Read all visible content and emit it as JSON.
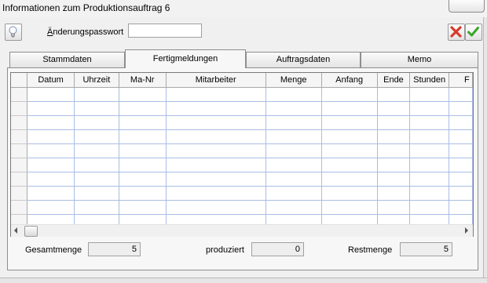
{
  "window": {
    "title": "Informationen zum Produktionsauftrag 6"
  },
  "toolbar": {
    "password_label": "Änderungspasswort",
    "password_value": "",
    "hint_icon": "lightbulb-icon",
    "cancel_icon": "red-x-icon",
    "ok_icon": "green-check-icon"
  },
  "tabs": [
    {
      "label": "Stammdaten",
      "active": false
    },
    {
      "label": "Fertigmeldungen",
      "active": true
    },
    {
      "label": "Auftragsdaten",
      "active": false
    },
    {
      "label": "Memo",
      "active": false
    }
  ],
  "grid": {
    "columns": [
      "Datum",
      "Uhrzeit",
      "Ma-Nr",
      "Mitarbeiter",
      "Menge",
      "Anfang",
      "Ende",
      "Stunden",
      "F"
    ],
    "rows": [
      [
        "",
        "",
        "",
        "",
        "",
        "",
        "",
        "",
        ""
      ],
      [
        "",
        "",
        "",
        "",
        "",
        "",
        "",
        "",
        ""
      ],
      [
        "",
        "",
        "",
        "",
        "",
        "",
        "",
        "",
        ""
      ],
      [
        "",
        "",
        "",
        "",
        "",
        "",
        "",
        "",
        ""
      ],
      [
        "",
        "",
        "",
        "",
        "",
        "",
        "",
        "",
        ""
      ],
      [
        "",
        "",
        "",
        "",
        "",
        "",
        "",
        "",
        ""
      ],
      [
        "",
        "",
        "",
        "",
        "",
        "",
        "",
        "",
        ""
      ],
      [
        "",
        "",
        "",
        "",
        "",
        "",
        "",
        "",
        ""
      ],
      [
        "",
        "",
        "",
        "",
        "",
        "",
        "",
        "",
        ""
      ],
      [
        "",
        "",
        "",
        "",
        "",
        "",
        "",
        "",
        ""
      ]
    ]
  },
  "footer": {
    "gesamtmenge_label": "Gesamtmenge",
    "gesamtmenge_value": "5",
    "produziert_label": "produziert",
    "produziert_value": "0",
    "restmenge_label": "Restmenge",
    "restmenge_value": "5"
  },
  "colors": {
    "grid_line": "#a9bde3",
    "cancel_red": "#d93b2b",
    "ok_green": "#3aa52a"
  }
}
